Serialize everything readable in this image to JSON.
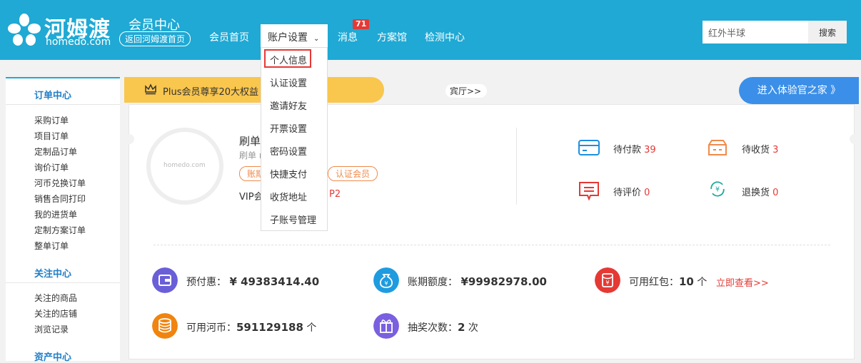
{
  "brand": {
    "name_cn": "河姆渡",
    "name_en": "homedo.com"
  },
  "header": {
    "title": "会员中心",
    "back_home": "返回河姆渡首页",
    "nav": {
      "home": "会员首页",
      "account": "账户设置",
      "messages": "消息",
      "solutions": "方案馆",
      "testing": "检测中心"
    },
    "messages_badge": "71",
    "search_value": "红外半球",
    "search_button": "搜索"
  },
  "dropdown": [
    "个人信息",
    "认证设置",
    "邀请好友",
    "开票设置",
    "密码设置",
    "快捷支付",
    "收货地址",
    "子账号管理"
  ],
  "sidebar": {
    "orders_title": "订单中心",
    "orders": [
      "采购订单",
      "项目订单",
      "定制品订单",
      "询价订单",
      "河币兑换订单",
      "销售合同打印",
      "我的进货单",
      "定制方案订单",
      "整单订单"
    ],
    "follow_title": "关注中心",
    "follow": [
      "关注的商品",
      "关注的店铺",
      "浏览记录"
    ],
    "assets_title": "资产中心"
  },
  "plus_bar": {
    "text": "Plus会员尊享20大权益",
    "hall": "宾厅>>"
  },
  "experience_button": "进入体验官之家 》",
  "profile": {
    "avatar_text": "homedo.com",
    "name": "刷单",
    "sub": "刷单 r",
    "tag1": "账期",
    "tag2": "认证会员",
    "vip": "VIP会",
    "vip_level": "P2"
  },
  "status": {
    "pay_label": "待付款",
    "pay_count": "39",
    "receive_label": "待收货",
    "receive_count": "3",
    "review_label": "待评价",
    "review_count": "0",
    "return_label": "退换货",
    "return_count": "0"
  },
  "stats": {
    "prepay_label": "预付惠：",
    "prepay_value": "¥ 49383414.40",
    "credit_label": "账期额度：",
    "credit_value": "¥99982978.00",
    "redpack_label": "可用红包：",
    "redpack_value": "10",
    "redpack_unit": "个",
    "redpack_link": "立即查看>>",
    "coins_label": "可用河币：",
    "coins_value": "591129188",
    "coins_unit": "个",
    "lottery_label": "抽奖次数：",
    "lottery_value": "2",
    "lottery_unit": "次"
  },
  "colors": {
    "header": "#1fa9d4",
    "accent_red": "#e53935",
    "link_blue": "#1f7ec8"
  }
}
